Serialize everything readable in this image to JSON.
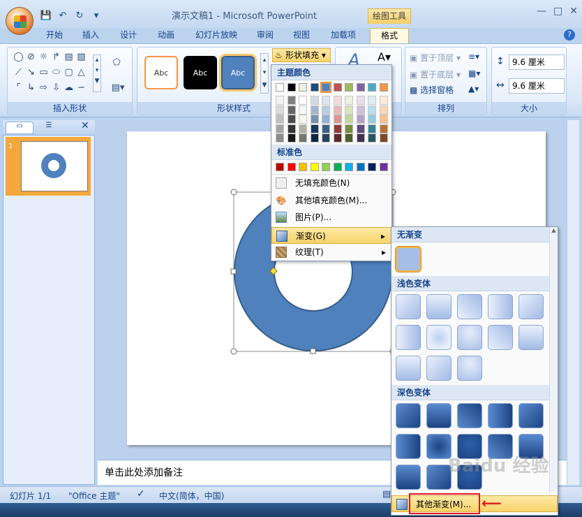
{
  "window": {
    "title": "演示文稿1 - Microsoft PowerPoint",
    "context_tab": "绘图工具"
  },
  "tabs": [
    "开始",
    "插入",
    "设计",
    "动画",
    "幻灯片放映",
    "审阅",
    "视图",
    "加载项",
    "格式"
  ],
  "ribbon": {
    "insert_shapes_label": "插入形状",
    "shape_styles_label": "形状样式",
    "style_sample": "Abc",
    "shape_fill_label": "形状填充",
    "bring_front": "置于顶层",
    "send_back": "置于底层",
    "selection_pane": "选择窗格",
    "arrange_label": "排列",
    "size_label": "大小",
    "height_value": "9.6 厘米",
    "width_value": "9.6 厘米"
  },
  "slide_panel": {
    "slide_number": "1"
  },
  "notes_placeholder": "单击此处添加备注",
  "status": {
    "slide_info": "幻灯片 1/1",
    "theme": "\"Office 主题\"",
    "language": "中文(简体，中国)"
  },
  "fill_menu": {
    "theme_colors_label": "主题颜色",
    "standard_colors_label": "标准色",
    "no_fill": "无填充颜色(N)",
    "more_colors": "其他填充颜色(M)...",
    "picture": "图片(P)...",
    "gradient": "渐变(G)",
    "texture": "纹理(T)",
    "theme_colors": [
      "#ffffff",
      "#000000",
      "#eeece1",
      "#1f497d",
      "#4f81bd",
      "#c0504d",
      "#9bbb59",
      "#8064a2",
      "#4bacc6",
      "#f79646"
    ],
    "standard_colors": [
      "#c00000",
      "#ff0000",
      "#ffc000",
      "#ffff00",
      "#92d050",
      "#00b050",
      "#00b0f0",
      "#0070c0",
      "#002060",
      "#7030a0"
    ]
  },
  "gradient_menu": {
    "no_gradient_label": "无渐变",
    "light_label": "浅色变体",
    "dark_label": "深色变体",
    "more_gradients": "其他渐变(M)..."
  },
  "shape": {
    "fill_color": "#4f81bd",
    "outline_color": "#385d8a"
  },
  "watermark": "Baidu 经验"
}
